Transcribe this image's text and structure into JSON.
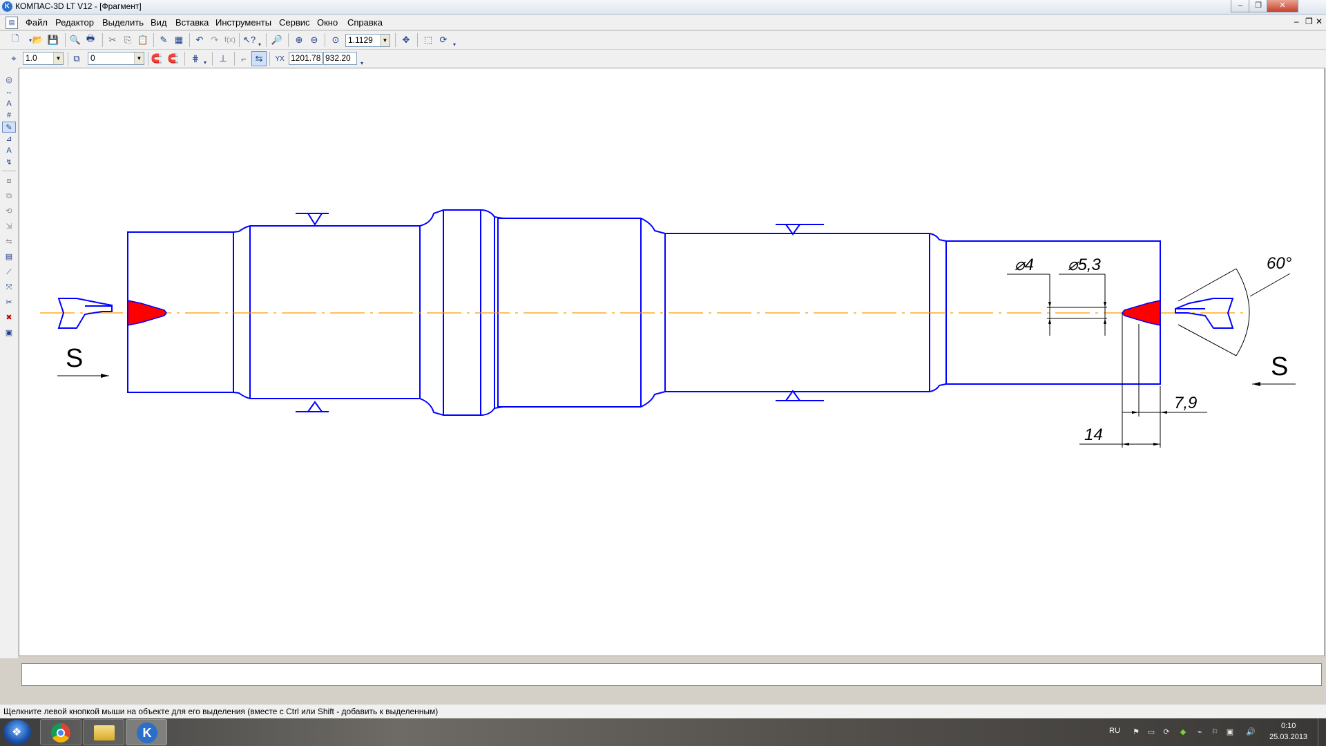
{
  "window": {
    "title": "КОМПАС-3D LT V12 - [Фрагмент]",
    "app_icon": "kompas-icon",
    "controls": [
      "minimize-icon",
      "maximize-icon",
      "close-icon"
    ],
    "doc_controls": [
      "–",
      "❐",
      "✕"
    ]
  },
  "menu": {
    "items": [
      "Файл",
      "Редактор",
      "Выделить",
      "Вид",
      "Вставка",
      "Инструменты",
      "Сервис",
      "Окно",
      "Справка"
    ]
  },
  "toolbar_main": {
    "zoom_value": "1.1129"
  },
  "toolbar_current_state": {
    "step_value": "1.0",
    "layer_value": "0",
    "coord_x": "1201.78",
    "coord_y": "932.20"
  },
  "drawing": {
    "line_color": "#0000ff",
    "axis_color": "#ff9900",
    "fill_color": "#ff0000",
    "labels": {
      "diam_small": "⌀4",
      "diam_large": "⌀5,3",
      "angle": "60°",
      "length_small": "7,9",
      "length_large": "14",
      "section_left": "S",
      "section_right": "S"
    }
  },
  "statusbar": {
    "message": "Щелкните левой кнопкой мыши на объекте для его выделения (вместе с Ctrl или Shift - добавить к выделенным)"
  },
  "taskbar": {
    "language": "RU",
    "time": "0:10",
    "date": "25.03.2013"
  }
}
